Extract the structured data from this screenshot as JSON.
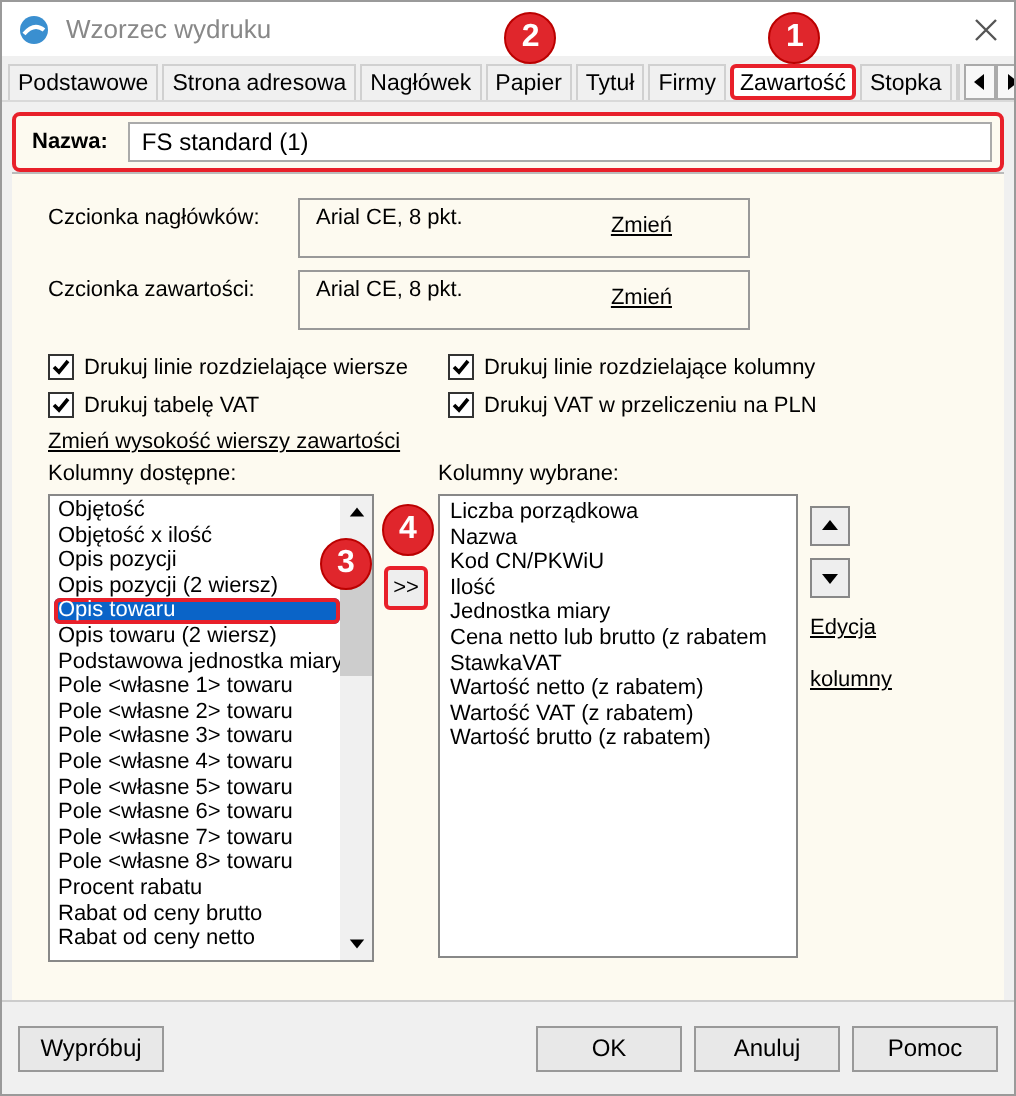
{
  "window": {
    "title": "Wzorzec wydruku"
  },
  "tabs": [
    {
      "label": "Podstawowe",
      "selected": false
    },
    {
      "label": "Strona adresowa",
      "selected": false
    },
    {
      "label": "Nagłówek",
      "selected": false
    },
    {
      "label": "Papier",
      "selected": false,
      "callout": "2"
    },
    {
      "label": "Tytuł",
      "selected": false
    },
    {
      "label": "Firmy",
      "selected": false
    },
    {
      "label": "Zawartość",
      "selected": true,
      "callout": "1",
      "highlighted": true
    },
    {
      "label": "Stopka",
      "selected": false
    }
  ],
  "name_field": {
    "label": "Nazwa:",
    "value": "FS standard (1)",
    "highlighted": true
  },
  "fonts": [
    {
      "label": "Czcionka nagłówków:",
      "value": "Arial CE, 8 pkt.",
      "link": "Zmień"
    },
    {
      "label": "Czcionka zawartości:",
      "value": "Arial CE, 8 pkt.",
      "link": "Zmień"
    }
  ],
  "checkboxes": [
    {
      "label": "Drukuj linie rozdzielające wiersze",
      "checked": true
    },
    {
      "label": "Drukuj linie rozdzielające kolumny",
      "checked": true
    },
    {
      "label": "Drukuj tabelę VAT",
      "checked": true
    },
    {
      "label": "Drukuj VAT w przeliczeniu na PLN",
      "checked": true
    }
  ],
  "row_height_link": "Zmień wysokość wierszy zawartości",
  "available": {
    "label": "Kolumny dostępne:",
    "items": [
      {
        "text": "Objętość",
        "selected": false
      },
      {
        "text": "Objętość x ilość",
        "selected": false
      },
      {
        "text": "Opis pozycji",
        "selected": false,
        "callout": "3"
      },
      {
        "text": "Opis pozycji (2 wiersz)",
        "selected": false
      },
      {
        "text": "Opis towaru",
        "selected": true,
        "highlighted": true
      },
      {
        "text": "Opis towaru (2 wiersz)",
        "selected": false
      },
      {
        "text": "Podstawowa jednostka miary",
        "selected": false
      },
      {
        "text": "Pole <własne 1> towaru",
        "selected": false
      },
      {
        "text": "Pole <własne 2> towaru",
        "selected": false
      },
      {
        "text": "Pole <własne 3> towaru",
        "selected": false
      },
      {
        "text": "Pole <własne 4> towaru",
        "selected": false
      },
      {
        "text": "Pole <własne 5> towaru",
        "selected": false
      },
      {
        "text": "Pole <własne 6> towaru",
        "selected": false
      },
      {
        "text": "Pole <własne 7> towaru",
        "selected": false
      },
      {
        "text": "Pole <własne 8> towaru",
        "selected": false
      },
      {
        "text": "Procent rabatu",
        "selected": false
      },
      {
        "text": "Rabat od ceny brutto",
        "selected": false
      },
      {
        "text": "Rabat od ceny netto",
        "selected": false
      }
    ]
  },
  "move_callout": "4",
  "move_buttons": [
    {
      "label": ">>",
      "highlighted": true
    }
  ],
  "chosen": {
    "label": "Kolumny wybrane:",
    "items": [
      "Liczba porządkowa",
      "Nazwa",
      "Kod CN/PKWiU",
      "Ilość",
      "Jednostka miary",
      "Cena netto lub brutto (z rabatem",
      "StawkaVAT",
      "Wartość netto (z rabatem)",
      "Wartość VAT (z rabatem)",
      "Wartość brutto (z rabatem)"
    ]
  },
  "edit_link": "Edycja kolumny",
  "buttons_left": [
    "Wypróbuj"
  ],
  "buttons_right": [
    "OK",
    "Anuluj",
    "Pomoc"
  ]
}
